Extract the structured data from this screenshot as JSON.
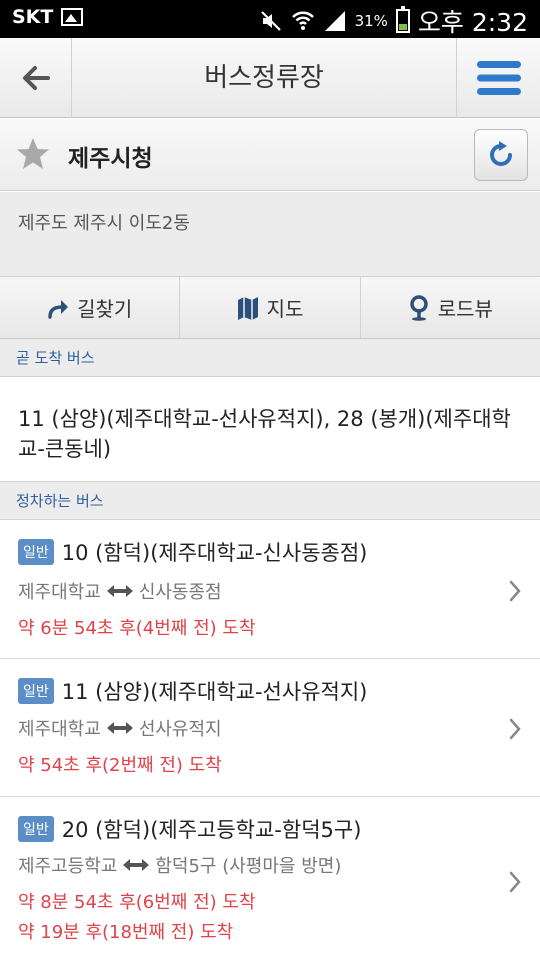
{
  "status_bar": {
    "carrier": "SKT",
    "battery": "31%",
    "battery_level": 0.31,
    "time": "오후 2:32",
    "icons": [
      "image-icon",
      "mute-icon",
      "wifi-icon",
      "signal-icon",
      "battery-icon"
    ]
  },
  "header": {
    "title": "버스정류장",
    "icons": [
      "back-arrow-icon",
      "menu-icon"
    ]
  },
  "stop": {
    "name": "제주시청",
    "address": "제주도 제주시 이도2동",
    "icons": [
      "star-icon",
      "refresh-icon"
    ]
  },
  "actions": [
    {
      "label": "길찾기",
      "icon": "directions-icon"
    },
    {
      "label": "지도",
      "icon": "map-icon"
    },
    {
      "label": "로드뷰",
      "icon": "roadview-pin-icon"
    }
  ],
  "sections": {
    "arriving_soon": "곧 도착 버스",
    "stopping": "정차하는 버스"
  },
  "arriving_soon_text": "11 (삼양)(제주대학교-선사유적지), 28 (봉개)(제주대학교-큰동네)",
  "buses": [
    {
      "badge": "일반",
      "name": "10 (함덕)(제주대학교-신사동종점)",
      "from": "제주대학교",
      "to": "신사동종점",
      "arrivals": [
        "약 6분 54초 후(4번째 전) 도착"
      ]
    },
    {
      "badge": "일반",
      "name": "11 (삼양)(제주대학교-선사유적지)",
      "from": "제주대학교",
      "to": "선사유적지",
      "arrivals": [
        "약 54초 후(2번째 전) 도착"
      ]
    },
    {
      "badge": "일반",
      "name": "20 (함덕)(제주고등학교-함덕5구)",
      "from": "제주고등학교",
      "to": "함덕5구 (사평마을 방면)",
      "arrivals": [
        "약 8분 54초 후(6번째 전) 도착",
        "약 19분 후(18번째 전) 도착"
      ]
    }
  ],
  "colors": {
    "accent_blue": "#2d5f9e",
    "badge": "#5b8ec6",
    "arrival_red": "#e0434a",
    "menu_blue": "#2f79c9"
  }
}
